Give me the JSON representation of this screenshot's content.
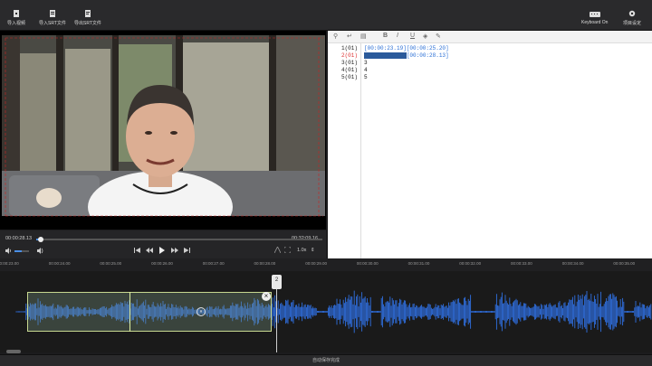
{
  "toolbar": {
    "import_video": "导入视频",
    "import_srt": "导入SRT文件",
    "export_srt": "导出SRT文件",
    "keyboard": "Keyboard On",
    "settings": "项目设定"
  },
  "player": {
    "current_time": "00:00:28.13",
    "total_time": "00:32:09.16",
    "speed": "1.0x",
    "progress": 0.015,
    "volume": 0.5
  },
  "editor": {
    "lines": [
      {
        "num": "1(01)",
        "text": "[00:00:23.19][00:00:25.20]"
      },
      {
        "num": "2(01)",
        "selected": "[00:00:25.20]",
        "text": "[00:00:28.13]",
        "active": true
      },
      {
        "num": "3(01)",
        "text": "3"
      },
      {
        "num": "4(01)",
        "text": "4"
      },
      {
        "num": "5(01)",
        "text": "5"
      }
    ]
  },
  "timeline": {
    "ticks": [
      "00:00:23.00",
      "00:00:24.00",
      "00:00:25.00",
      "00:00:26.00",
      "00:00:27.00",
      "00:00:28.00",
      "00:00:29.00",
      "00:00:30.00",
      "00:00:31.00",
      "00:00:32.00",
      "00:00:33.00",
      "00:00:34.00",
      "00:00:35.00"
    ],
    "marker": "2"
  },
  "status": "自动保存完成"
}
